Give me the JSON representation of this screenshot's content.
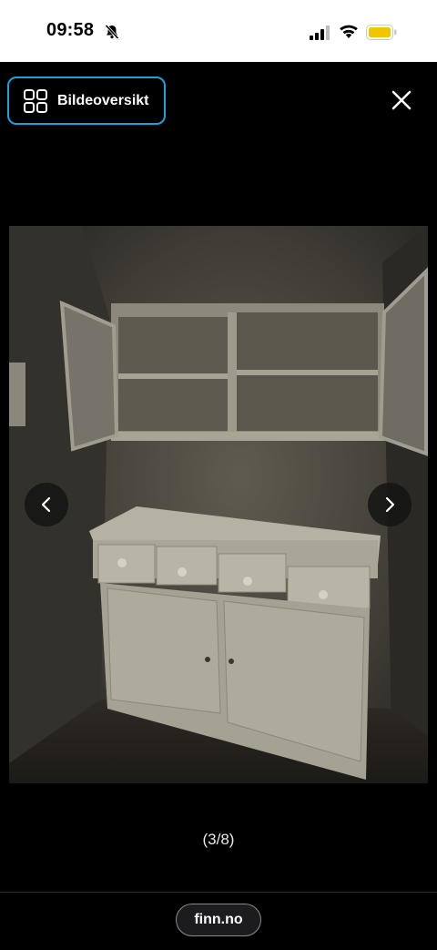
{
  "status_bar": {
    "time": "09:58",
    "icons": [
      "bell-slash-icon",
      "cellular-signal-icon",
      "wifi-icon",
      "battery-icon"
    ],
    "battery_color": "#f5c400"
  },
  "viewer": {
    "overview_label": "Bildeoversikt",
    "overview_icon": "grid-icon",
    "close_icon": "close-icon",
    "counter": "(3/8)",
    "prev_icon": "chevron-left-icon",
    "next_icon": "chevron-right-icon",
    "accent": "#1aa3d9"
  },
  "footer": {
    "site_label": "finn.no"
  }
}
